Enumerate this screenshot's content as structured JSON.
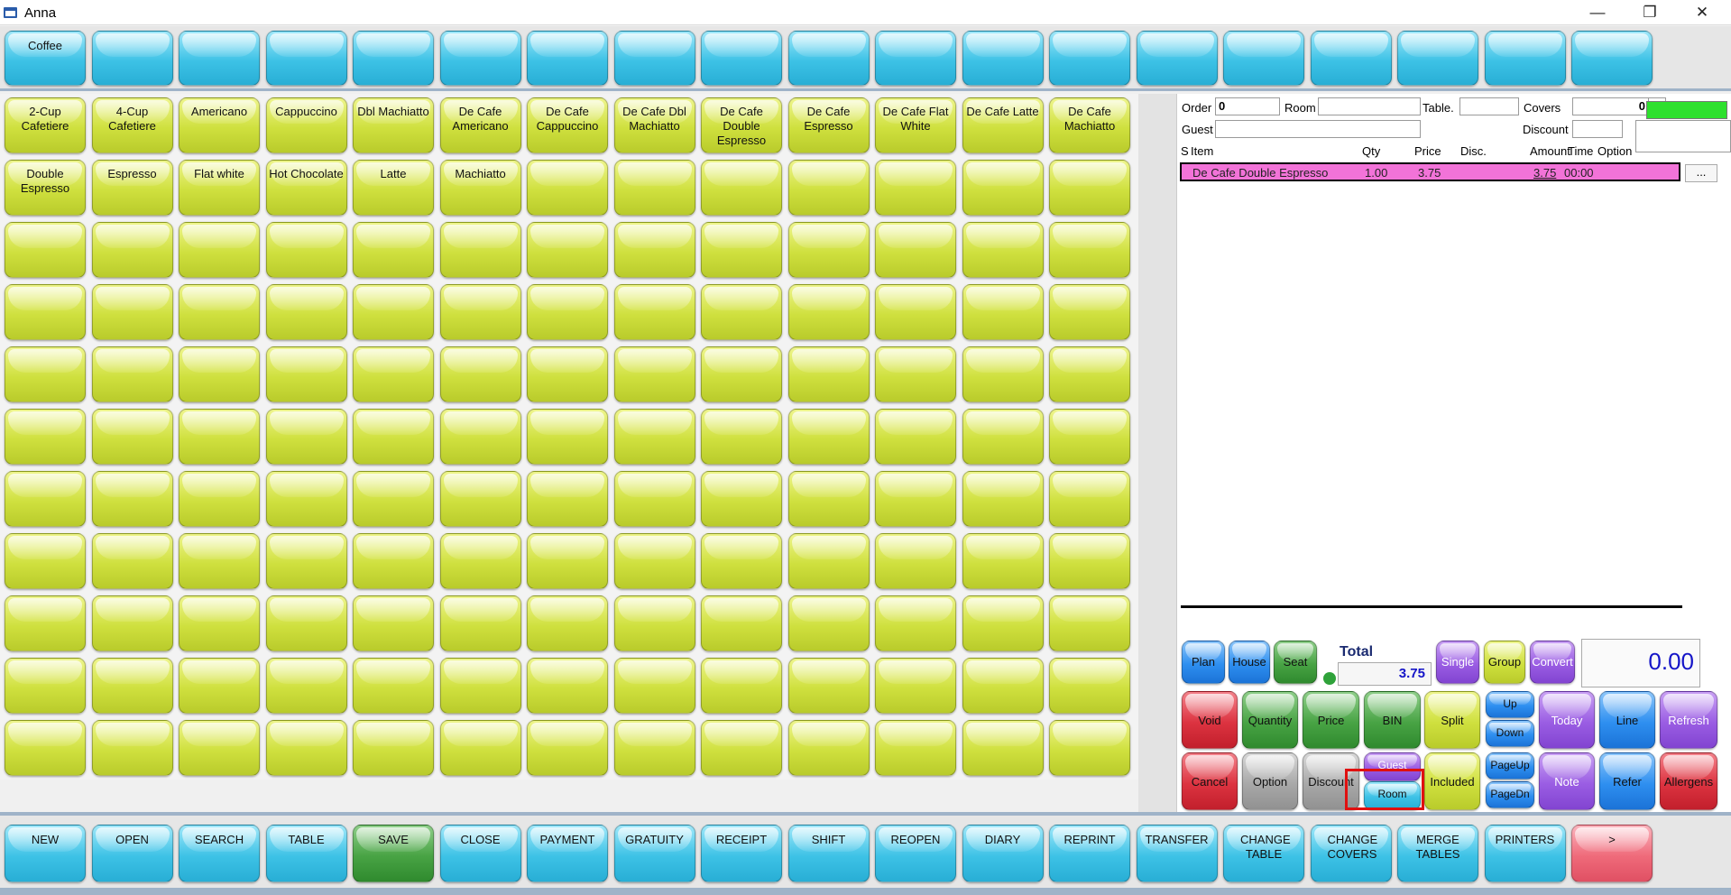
{
  "window": {
    "title": "Anna",
    "controls": [
      "—",
      "❐",
      "✕"
    ]
  },
  "category_tabs": [
    "Coffee",
    "",
    "",
    "",
    "",
    "",
    "",
    "",
    "",
    "",
    "",
    "",
    "",
    "",
    "",
    "",
    "",
    "",
    ""
  ],
  "items_row1": [
    "2-Cup Cafetiere",
    "4-Cup Cafetiere",
    "Americano",
    "Cappuccino",
    "Dbl Machiatto",
    "De Cafe Americano",
    "De Cafe Cappuccino",
    "De Cafe Dbl Machiatto",
    "De Cafe Double Espresso",
    "De Cafe Espresso",
    "De Cafe Flat White",
    "De Cafe Latte",
    "De Cafe Machiatto"
  ],
  "items_row2": [
    "Double Espresso",
    "Espresso",
    "Flat white",
    "Hot Chocolate",
    "Latte",
    "Machiatto",
    "",
    "",
    "",
    "",
    "",
    "",
    ""
  ],
  "order": {
    "labels": {
      "order": "Order",
      "room": "Room",
      "table": "Table.",
      "covers": "Covers",
      "guest": "Guest",
      "discount": "Discount"
    },
    "fields": {
      "order": "0",
      "room": "",
      "table": "",
      "covers": "0",
      "guest": "",
      "discount": ""
    },
    "columns": [
      "S",
      "Item",
      "Qty",
      "Price",
      "Disc.",
      "Amount",
      "Time",
      "Option"
    ],
    "line": {
      "item": "De Cafe Double Espresso",
      "qty": "1.00",
      "price": "3.75",
      "disc": "",
      "amount": "3.75",
      "time": "00:00"
    },
    "more_label": "...",
    "total_label": "Total",
    "total_value": "3.75",
    "amount_display": "0.00",
    "status_color": "#2ee02e"
  },
  "keypad": {
    "plan": "Plan",
    "house": "House",
    "seat": "Seat",
    "single": "Single",
    "group": "Group",
    "convert": "Convert",
    "void": "Void",
    "quantity": "Quantity",
    "price": "Price",
    "bin": "BIN",
    "split": "Split",
    "up": "Up",
    "down": "Down",
    "today": "Today",
    "line": "Line",
    "refresh": "Refresh",
    "cancel": "Cancel",
    "option": "Option",
    "discount": "Discount",
    "guest": "Guest",
    "room": "Room",
    "included": "Included",
    "pageup": "PageUp",
    "pagedn": "PageDn",
    "note": "Note",
    "refer": "Refer",
    "allergens": "Allergens"
  },
  "function_bar": [
    "NEW",
    "OPEN",
    "SEARCH",
    "TABLE",
    "SAVE",
    "CLOSE",
    "PAYMENT",
    "GRATUITY",
    "RECEIPT",
    "SHIFT",
    "REOPEN",
    "DIARY",
    "REPRINT",
    "TRANSFER",
    "CHANGE TABLE",
    "CHANGE COVERS",
    "MERGE TABLES",
    "PRINTERS",
    ">"
  ]
}
